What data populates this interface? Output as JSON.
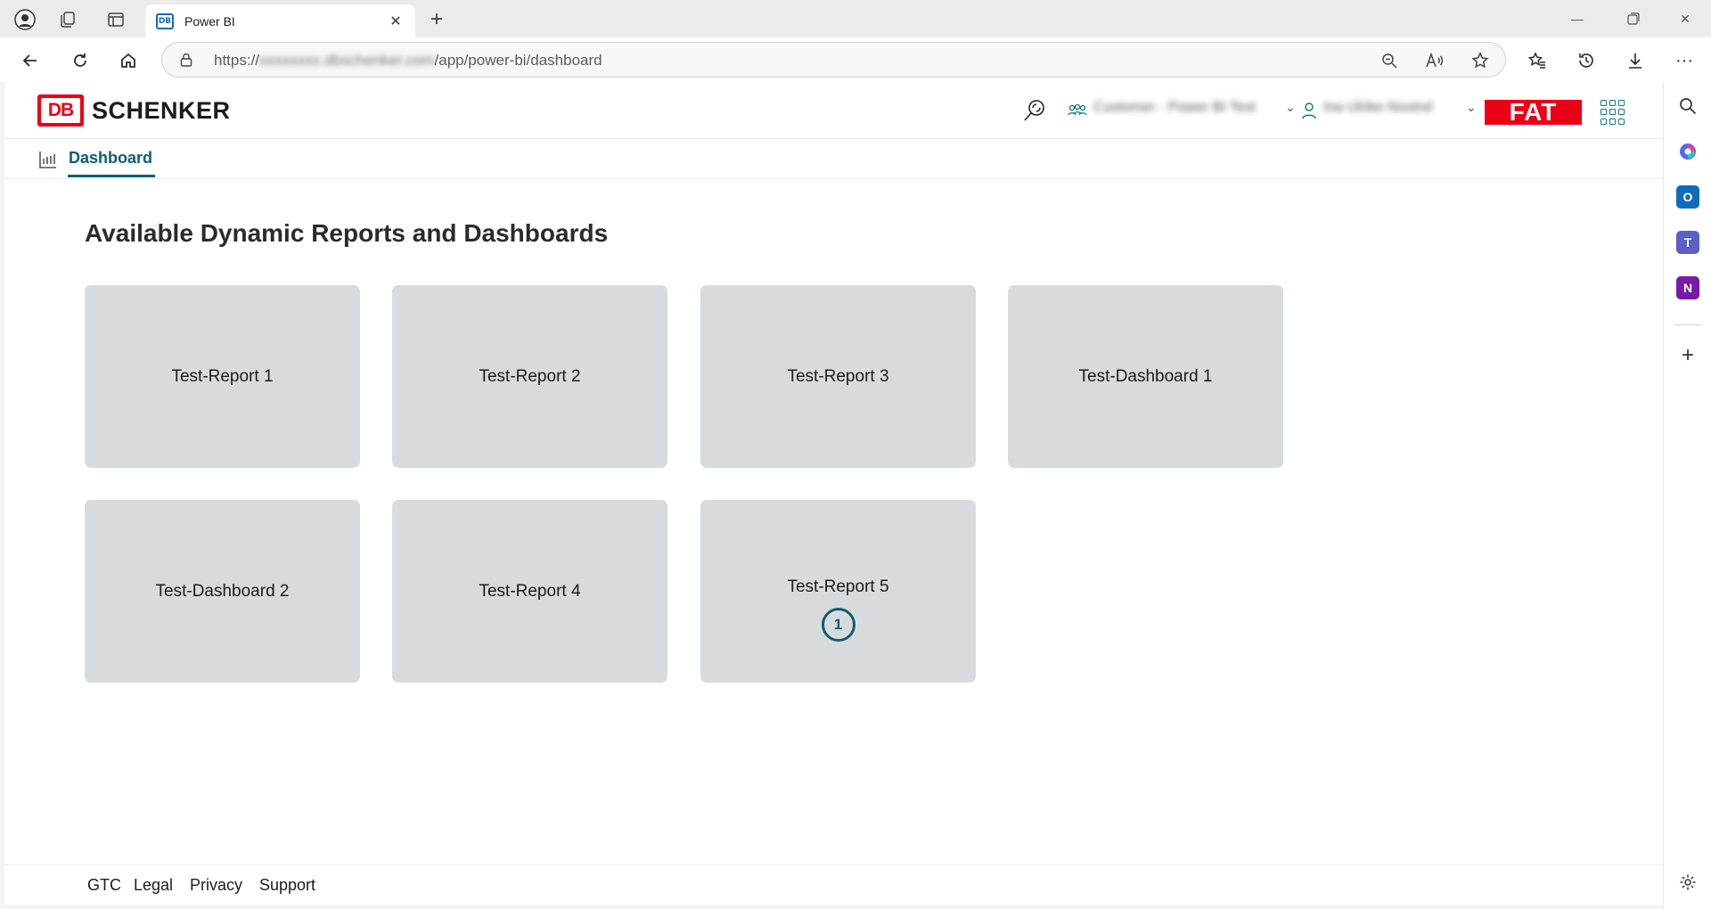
{
  "browser": {
    "tab": {
      "title": "Power BI",
      "favicon_text": "DB"
    },
    "address": {
      "prefix": "https://",
      "host_obscured": "xxxxxxxx.dbschenker.com",
      "path": "/app/power-bi/dashboard"
    }
  },
  "header": {
    "logo_text": "DB",
    "brand": "SCHENKER",
    "customer_obscured": "Customer - Power BI Test",
    "user_obscured": "Ina Ulrike Nostrel",
    "environment_badge": "FAT",
    "accent_color": "#ec0016"
  },
  "subnav": {
    "label": "Dashboard",
    "color": "#0e5e6f"
  },
  "main": {
    "title": "Available Dynamic Reports and Dashboards",
    "cards": [
      {
        "label": "Test-Report 1"
      },
      {
        "label": "Test-Report 2"
      },
      {
        "label": "Test-Report 3"
      },
      {
        "label": "Test-Dashboard 1"
      },
      {
        "label": "Test-Dashboard 2"
      },
      {
        "label": "Test-Report 4"
      },
      {
        "label": "Test-Report 5",
        "badge": "1"
      }
    ]
  },
  "footer": {
    "links": [
      "GTC",
      "Legal",
      "Privacy",
      "Support"
    ]
  },
  "sidebar": {
    "items": [
      {
        "icon": "search-icon"
      },
      {
        "icon": "copilot-icon"
      },
      {
        "icon": "outlook-icon",
        "letter": "O"
      },
      {
        "icon": "teams-icon",
        "letter": "T"
      },
      {
        "icon": "onenote-icon",
        "letter": "N"
      },
      {
        "icon": "add-icon"
      },
      {
        "icon": "settings-icon"
      }
    ]
  }
}
